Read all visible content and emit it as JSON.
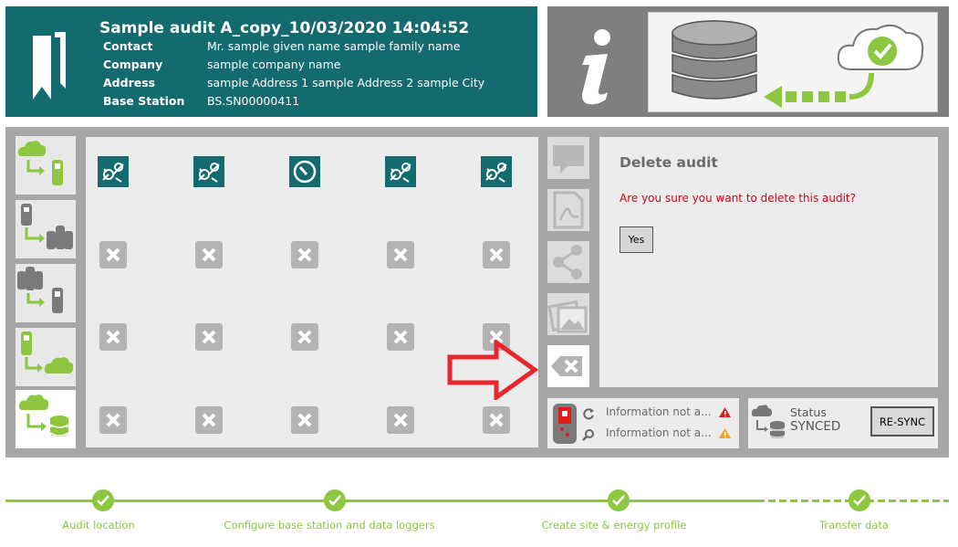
{
  "header": {
    "title": "Sample audit A_copy_10/03/2020 14:04:52",
    "fields": [
      {
        "label": "Contact",
        "value": "Mr. sample given name sample family name"
      },
      {
        "label": "Company",
        "value": "sample company name"
      },
      {
        "label": "Address",
        "value": "sample Address 1 sample Address 2 sample City"
      },
      {
        "label": "Base Station",
        "value": "BS.SN00000411"
      }
    ]
  },
  "nav": {
    "items": [
      {
        "icon": "cloud-to-logger-icon",
        "active": false
      },
      {
        "icon": "loggers-to-devices-icon",
        "active": false
      },
      {
        "icon": "devices-to-logger-icon",
        "active": false
      },
      {
        "icon": "logger-to-cloud-icon",
        "active": false
      },
      {
        "icon": "cloud-to-database-icon",
        "active": true
      }
    ]
  },
  "grid": {
    "header_icons": [
      "sensor-icon",
      "sensor-icon",
      "gauge-icon",
      "sensor-icon",
      "sensor-icon"
    ],
    "rows": 3
  },
  "side_tools": [
    {
      "icon": "comment-icon"
    },
    {
      "icon": "pdf-icon"
    },
    {
      "icon": "share-icon"
    },
    {
      "icon": "image-icon"
    },
    {
      "icon": "delete-icon"
    }
  ],
  "dialog": {
    "title": "Delete audit",
    "message": "Are you sure you want to delete this audit?",
    "yes_label": "Yes"
  },
  "info_status": {
    "line1": "Information not a...",
    "line2": "Information not a..."
  },
  "sync": {
    "status_label": "Status",
    "status_value": "SYNCED",
    "resync_label": "RE-SYNC"
  },
  "steps": [
    {
      "label": "Audit location"
    },
    {
      "label": "Configure base station and data loggers"
    },
    {
      "label": "Create site & energy profile"
    },
    {
      "label": "Transfer data"
    }
  ],
  "colors": {
    "teal": "#136a6f",
    "green": "#8dc63f",
    "panel_grey": "#a6a6a6",
    "alert_red": "#d0021b"
  }
}
